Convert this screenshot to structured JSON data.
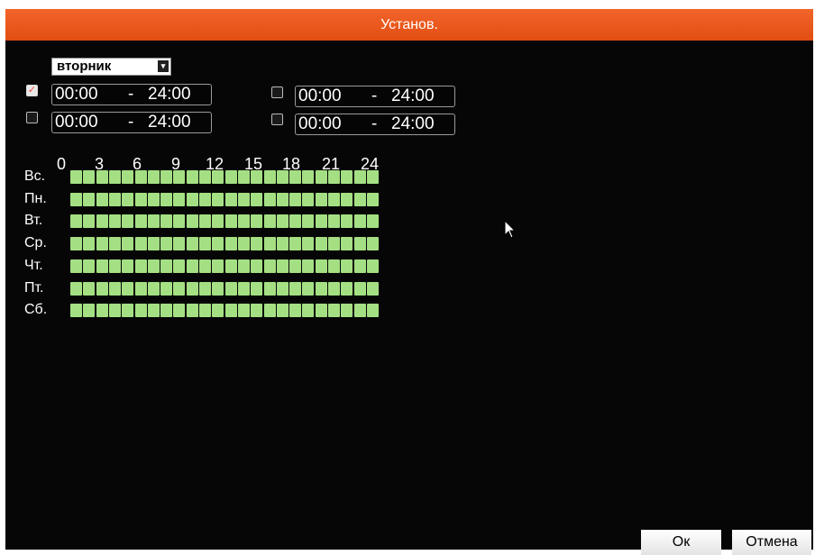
{
  "window": {
    "title": "Установ."
  },
  "day_select": {
    "value": "вторник",
    "arrow": "▾"
  },
  "periods": [
    {
      "checked": true,
      "start": "00:00",
      "sep": "-",
      "end": "24:00"
    },
    {
      "checked": false,
      "start": "00:00",
      "sep": "-",
      "end": "24:00"
    },
    {
      "checked": false,
      "start": "00:00",
      "sep": "-",
      "end": "24:00"
    },
    {
      "checked": false,
      "start": "00:00",
      "sep": "-",
      "end": "24:00"
    }
  ],
  "schedule": {
    "hour_labels": [
      "0",
      "3",
      "6",
      "9",
      "12",
      "15",
      "18",
      "21",
      "24"
    ],
    "days": [
      "Вс.",
      "Пн.",
      "Вт.",
      "Ср.",
      "Чт.",
      "Пт.",
      "Сб."
    ],
    "active_color": "#a4e083",
    "slots_per_day": 24,
    "all_active": true
  },
  "buttons": {
    "ok": "Ок",
    "cancel": "Отмена"
  },
  "colors": {
    "title_bar": "#e9561b",
    "background": "#060606"
  },
  "icons": {
    "check": "check-icon",
    "cursor": "mouse-cursor-icon"
  }
}
